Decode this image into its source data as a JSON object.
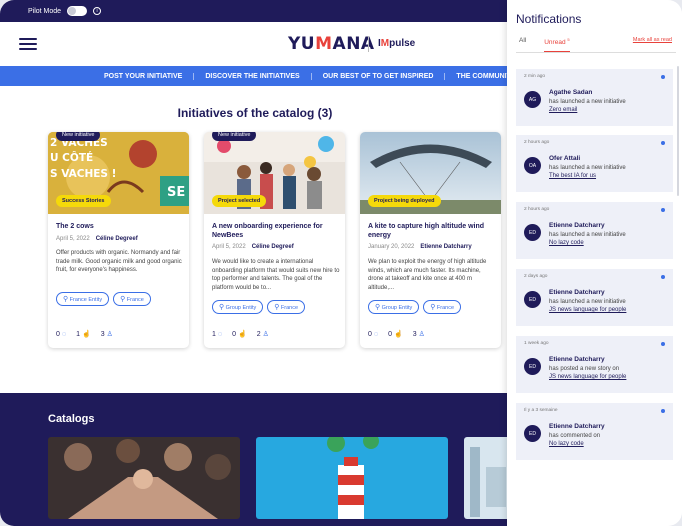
{
  "topbar": {
    "pilot_label": "Pilot Mode"
  },
  "header": {
    "logo_a": "YU",
    "logo_b": "M",
    "logo_c": "ANA",
    "logo2_a": "I",
    "logo2_b": "M",
    "logo2_c": "pulse"
  },
  "nav": {
    "items": [
      "POST YOUR INITIATIVE",
      "DISCOVER THE INITIATIVES",
      "OUR BEST OF TO GET INSPIRED",
      "THE COMMUNITY"
    ]
  },
  "initiatives": {
    "title": "Initiatives of the catalog (3)",
    "cards": [
      {
        "new_tag": "New initiative",
        "badge": "Success Stories",
        "title": "The 2 cows",
        "date": "April 5, 2022",
        "author": "Céline Degreef",
        "desc": "Offer products with organic. Normandy and fair trade milk. Good organic milk and good organic fruit, for everyone's happiness.",
        "pills": [
          "France Entity",
          "France"
        ],
        "comments": "0",
        "likes": "1",
        "members": "3"
      },
      {
        "new_tag": "New initiative",
        "badge": "Project selected",
        "title": "A new onboarding experience for NewBees",
        "date": "April 5, 2022",
        "author": "Céline Degreef",
        "desc": "We would like to create a international onboarding platform that would suits new hire to top performer and talents. The goal of the platform would be to...",
        "pills": [
          "Group Entity",
          "France"
        ],
        "comments": "1",
        "likes": "0",
        "members": "2"
      },
      {
        "badge": "Project being deployed",
        "title": "A kite to capture high altitude wind energy",
        "date": "January 20, 2022",
        "author": "Etienne Datcharry",
        "desc": "We plan to exploit the energy of high altitude winds, which are much faster. Its machine, drone at takeoff and kite once at 400 m altitude,...",
        "pills": [
          "Group Entity",
          "France"
        ],
        "comments": "0",
        "likes": "0",
        "members": "3"
      }
    ],
    "card1_image_text": [
      "2 VACHES",
      "U CÔTÉ",
      "S VACHES !"
    ],
    "card1_image_tag": "SE"
  },
  "catalogs": {
    "title": "Catalogs"
  },
  "notifications": {
    "title": "Notifications",
    "tab_all": "All",
    "tab_unread": "Unread",
    "unread_count": "5",
    "mark_all": "Mark all as read",
    "items": [
      {
        "time": "2 min ago",
        "initials": "AG",
        "name": "Agathe Sadan",
        "action": "has launched a new initiative",
        "link": "Zero email"
      },
      {
        "time": "2 hours ago",
        "initials": "OA",
        "name": "Ofer Attali",
        "action": "has launched a new initiative",
        "link": "The best IA for us"
      },
      {
        "time": "2 hours ago",
        "initials": "ED",
        "name": "Etienne Datcharry",
        "action": "has launched a new initiative",
        "link": "No lazy code"
      },
      {
        "time": "2 days ago",
        "initials": "ED",
        "name": "Etienne Datcharry",
        "action": "has launched a new initiative",
        "link": "JS news language for people"
      },
      {
        "time": "1 week ago",
        "initials": "ED",
        "name": "Etienne Datcharry",
        "action": "has posted a new story on",
        "link": "JS news language for people"
      },
      {
        "time": "Il y a 3 semaine",
        "initials": "ED",
        "name": "Etienne Datcharry",
        "action": "has commented on",
        "link": "No lazy code"
      }
    ]
  },
  "colors": {
    "navy": "#1f1b5a",
    "blue": "#3b6fe6",
    "red": "#e8423b",
    "yellow": "#f5d90a"
  }
}
